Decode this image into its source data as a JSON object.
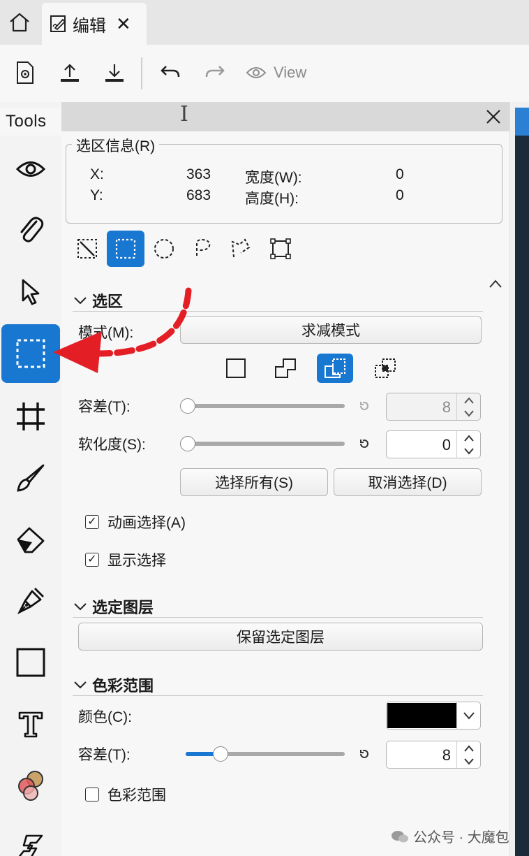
{
  "tabs": [
    {
      "label": "编辑"
    }
  ],
  "toolbar": {
    "view_label": "View"
  },
  "rail": {
    "title": "Tools",
    "items": [
      "eye-icon",
      "paperclip-icon",
      "arrow-pointer-icon",
      "rect-select-icon",
      "crop-icon",
      "brush-icon",
      "eraser-icon",
      "pen-icon",
      "rectangle-icon",
      "text-icon",
      "color-blend-icon",
      "script-icon"
    ],
    "active_item": "rect-select-icon"
  },
  "selection_info": {
    "title": "选区信息(R)",
    "x_label": "X:",
    "x_value": "363",
    "y_label": "Y:",
    "y_value": "683",
    "width_label": "宽度(W):",
    "width_value": "0",
    "height_label": "高度(H):",
    "height_value": "0"
  },
  "shape_tools": {
    "items": [
      "magic-select-icon",
      "rect-marquee-icon",
      "ellipse-marquee-icon",
      "lasso-icon",
      "polygon-lasso-icon",
      "transform-select-icon"
    ],
    "active": "rect-marquee-icon"
  },
  "selection": {
    "title": "选区",
    "mode_label": "模式(M):",
    "mode_value": "求减模式",
    "mode_icons": [
      "new-selection-icon",
      "add-selection-icon",
      "subtract-selection-icon",
      "intersect-selection-icon"
    ],
    "active_mode": "subtract-selection-icon",
    "tolerance_label": "容差(T):",
    "tolerance_value": "8",
    "tolerance_slider_fraction": 0.0,
    "feather_label": "软化度(S):",
    "feather_value": "0",
    "feather_slider_fraction": 0.0,
    "select_all": "选择所有(S)",
    "deselect": "取消选择(D)",
    "animate_label": "动画选择(A)",
    "animate_checked": true,
    "show_label": "显示选择",
    "show_checked": true
  },
  "selected_layer": {
    "title": "选定图层",
    "keep_button": "保留选定图层"
  },
  "color_range": {
    "title": "色彩范围",
    "color_label": "颜色(C):",
    "color_value": "#000000",
    "tolerance_label": "容差(T):",
    "tolerance_value": "8",
    "tolerance_slider_fraction": 0.22,
    "enable_label": "色彩范围",
    "enable_checked": false
  },
  "watermark": "公众号 · 大魔包",
  "colors": {
    "accent": "#1877d0",
    "annotation": "#e41e25"
  }
}
